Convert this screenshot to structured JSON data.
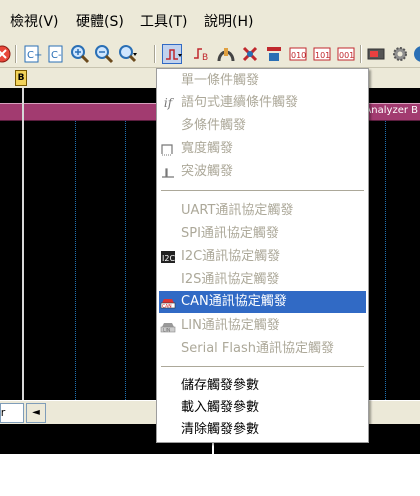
{
  "menubar": {
    "items": [
      {
        "label": "檢視(V)"
      },
      {
        "label": "硬體(S)"
      },
      {
        "label": "工具(T)"
      },
      {
        "label": "說明(H)"
      }
    ]
  },
  "toolbar": {
    "icons": [
      "stop-icon",
      "cursor-add-icon",
      "cursor-remove-icon",
      "zoom-in-icon",
      "zoom-out-icon",
      "zoom-fit-icon",
      "trigger-settings-icon",
      "trigger-edge-icon",
      "probe-icon",
      "channel-icon",
      "bus-icon",
      "decode-icon",
      "protocol-icon",
      "screen-icon",
      "settings-gear-icon",
      "info-icon"
    ]
  },
  "ruler": {
    "marker_label": "B"
  },
  "waveform": {
    "band_label": "Analyzer B"
  },
  "bottom": {
    "tab_label": "ger",
    "scroll_left": "◄"
  },
  "menu": {
    "items": [
      {
        "label": "單一條件觸發",
        "icon": "",
        "disabled": true
      },
      {
        "label": "語句式連續條件觸發",
        "icon": "if-icon",
        "disabled": true
      },
      {
        "label": "多條件觸發",
        "icon": "",
        "disabled": true
      },
      {
        "label": "寬度觸發",
        "icon": "pulse-width-icon",
        "disabled": true
      },
      {
        "label": "突波觸發",
        "icon": "glitch-icon",
        "disabled": true
      },
      {
        "label": "UART通訊協定觸發",
        "icon": "",
        "disabled": true
      },
      {
        "label": "SPI通訊協定觸發",
        "icon": "",
        "disabled": true
      },
      {
        "label": "I2C通訊協定觸發",
        "icon": "i2c-icon",
        "disabled": true
      },
      {
        "label": "I2S通訊協定觸發",
        "icon": "",
        "disabled": true
      },
      {
        "label": "CAN通訊協定觸發",
        "icon": "can-car-icon",
        "disabled": false,
        "selected": true
      },
      {
        "label": "LIN通訊協定觸發",
        "icon": "lin-car-icon",
        "disabled": true
      },
      {
        "label": "Serial Flash通訊協定觸發",
        "icon": "",
        "disabled": true
      },
      {
        "label": "儲存觸發參數",
        "icon": "",
        "disabled": false
      },
      {
        "label": "載入觸發參數",
        "icon": "",
        "disabled": false
      },
      {
        "label": "清除觸發參數",
        "icon": "",
        "disabled": false
      }
    ]
  }
}
